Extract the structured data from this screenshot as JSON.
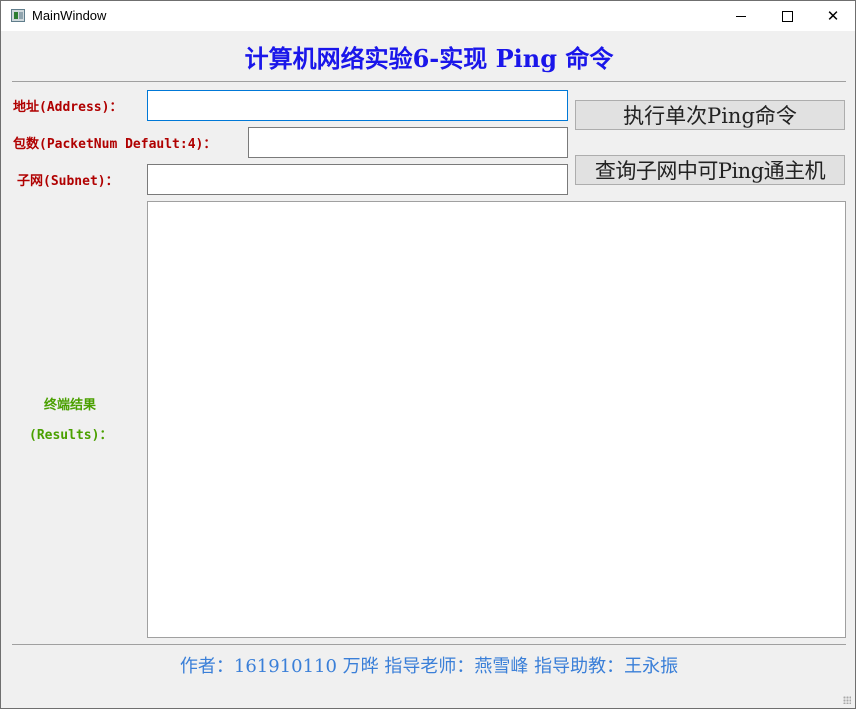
{
  "window": {
    "title": "MainWindow",
    "controls": {
      "minimize": "minimize-icon",
      "maximize": "maximize-icon",
      "close": "close-icon"
    }
  },
  "header": {
    "title": "计算机网络实验6-实现 Ping 命令"
  },
  "form": {
    "address_label": "地址(Address)：",
    "address_value": "",
    "packet_label": "包数(PacketNum Default:4)：",
    "packet_value": "",
    "subnet_label": "子网(Subnet)：",
    "subnet_value": ""
  },
  "buttons": {
    "ping_once": "执行单次Ping命令",
    "query_subnet": "查询子网中可Ping通主机"
  },
  "results": {
    "label_line1": "终端结果",
    "label_line2": "(Results)：",
    "content": ""
  },
  "footer": {
    "credits": "作者：161910110 万晔 指导老师：燕雪峰 指导助教：王永振"
  },
  "colors": {
    "heading": "#1a16ea",
    "form_label": "#b00000",
    "results_label": "#4aa000",
    "footer": "#3a7fd8",
    "focus_border": "#0078d7"
  }
}
